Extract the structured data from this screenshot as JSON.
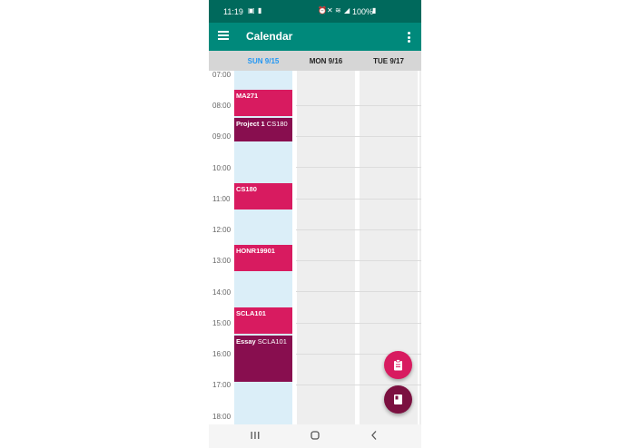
{
  "status_bar": {
    "time": "11:19",
    "battery": "100%",
    "left_icons": [
      "image-icon",
      "sim-icon"
    ],
    "right_icons": [
      "alarm-icon",
      "mute-icon",
      "wifi-icon",
      "signal-icon",
      "battery-icon"
    ]
  },
  "app_bar": {
    "title": "Calendar",
    "menu_icon": "hamburger-menu-icon",
    "more_icon": "more-vertical-icon"
  },
  "days": [
    {
      "label": "SUN 9/15",
      "selected": true,
      "color": "#2196f3"
    },
    {
      "label": "MON 9/16",
      "selected": false,
      "color": "#212121"
    },
    {
      "label": "TUE 9/17",
      "selected": false,
      "color": "#212121"
    }
  ],
  "hours": [
    "07:00",
    "08:00",
    "09:00",
    "10:00",
    "11:00",
    "12:00",
    "13:00",
    "14:00",
    "15:00",
    "16:00",
    "17:00",
    "18:00"
  ],
  "events": [
    {
      "title": "MA271",
      "subtitle": "",
      "type": "class"
    },
    {
      "title": "Project 1",
      "subtitle": "CS180",
      "type": "due"
    },
    {
      "title": "CS180",
      "subtitle": "",
      "type": "class"
    },
    {
      "title": "HONR19901",
      "subtitle": "",
      "type": "class"
    },
    {
      "title": "SCLA101",
      "subtitle": "",
      "type": "class"
    },
    {
      "title": "Essay",
      "subtitle": "SCLA101",
      "type": "due"
    }
  ],
  "fabs": [
    {
      "icon": "clipboard-icon",
      "color": "#d81b60"
    },
    {
      "icon": "book-icon",
      "color": "#7b1040"
    }
  ],
  "nav_bar": {
    "icons": [
      "recent-apps-icon",
      "home-icon",
      "back-icon"
    ]
  },
  "colors": {
    "status_bar": "#00695c",
    "app_bar": "#00897b",
    "class_event": "#d81b60",
    "due_event": "#880e4f",
    "today_column": "#dbeef8"
  }
}
